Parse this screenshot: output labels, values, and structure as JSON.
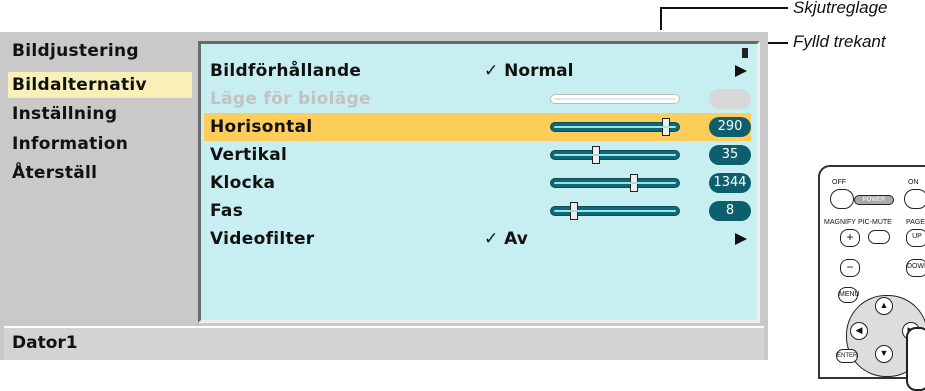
{
  "callouts": {
    "slider_label": "Skjutreglage",
    "triangle_label": "Fylld trekant"
  },
  "menu": {
    "items": [
      {
        "label": "Bildjustering",
        "active": false
      },
      {
        "label": "Bildalternativ",
        "active": true
      },
      {
        "label": "Inställning",
        "active": false
      },
      {
        "label": "Information",
        "active": false
      },
      {
        "label": "Återställ",
        "active": false
      }
    ]
  },
  "panel": {
    "rows": [
      {
        "label": "Bildförhållande",
        "value": "✓ Normal",
        "type": "select"
      },
      {
        "label": "Läge för bioläge",
        "type": "slider-disabled"
      },
      {
        "label": "Horisontal",
        "value": "290",
        "level": 0.9,
        "type": "slider",
        "highlighted": true
      },
      {
        "label": "Vertikal",
        "value": "35",
        "level": 0.35,
        "type": "slider"
      },
      {
        "label": "Klocka",
        "value": "1344",
        "level": 0.65,
        "type": "slider"
      },
      {
        "label": "Fas",
        "value": "8",
        "level": 0.18,
        "type": "slider"
      },
      {
        "label": "Videofilter",
        "value": "✓ Av",
        "type": "select"
      }
    ]
  },
  "status": {
    "source": "Dator1"
  },
  "remote": {
    "labels": {
      "off": "OFF",
      "on": "ON",
      "power": "POWER",
      "magnify": "MAGNIFY",
      "picmute": "PIC-MUTE",
      "page": "PAGE",
      "up": "UP",
      "down": "DOWN",
      "menu": "MENU",
      "enter": "ENTER",
      "plus": "+",
      "minus": "−"
    }
  },
  "colors": {
    "highlight": "#ffce5a",
    "active_menu": "#f8f0b6",
    "panel_bg": "#c7eef1",
    "slider": "#0d6a74"
  }
}
